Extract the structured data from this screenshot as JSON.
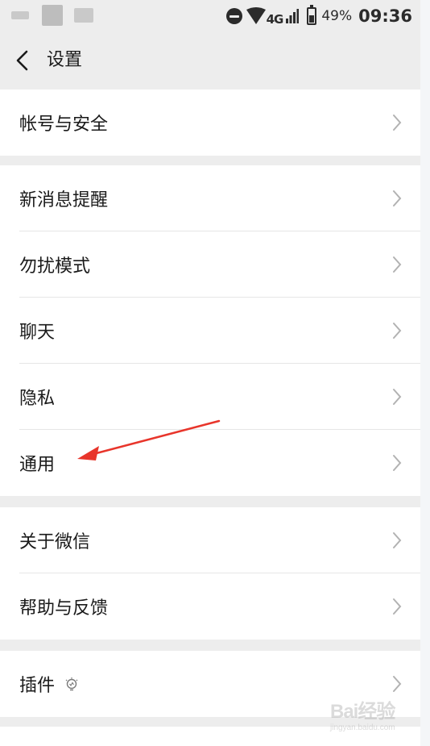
{
  "status_bar": {
    "network": "4G",
    "battery": "49%",
    "time": "09:36"
  },
  "header": {
    "title": "设置"
  },
  "sections": [
    {
      "items": [
        {
          "label": "帐号与安全"
        }
      ]
    },
    {
      "items": [
        {
          "label": "新消息提醒"
        },
        {
          "label": "勿扰模式"
        },
        {
          "label": "聊天"
        },
        {
          "label": "隐私"
        },
        {
          "label": "通用"
        }
      ]
    },
    {
      "items": [
        {
          "label": "关于微信"
        },
        {
          "label": "帮助与反馈"
        }
      ]
    },
    {
      "items": [
        {
          "label": "插件",
          "icon": "lightbulb-icon"
        }
      ]
    }
  ],
  "annotation": {
    "color": "#e8352b"
  },
  "watermark": {
    "text": "Bai经验",
    "sub": "jingyan.baidu.com"
  }
}
